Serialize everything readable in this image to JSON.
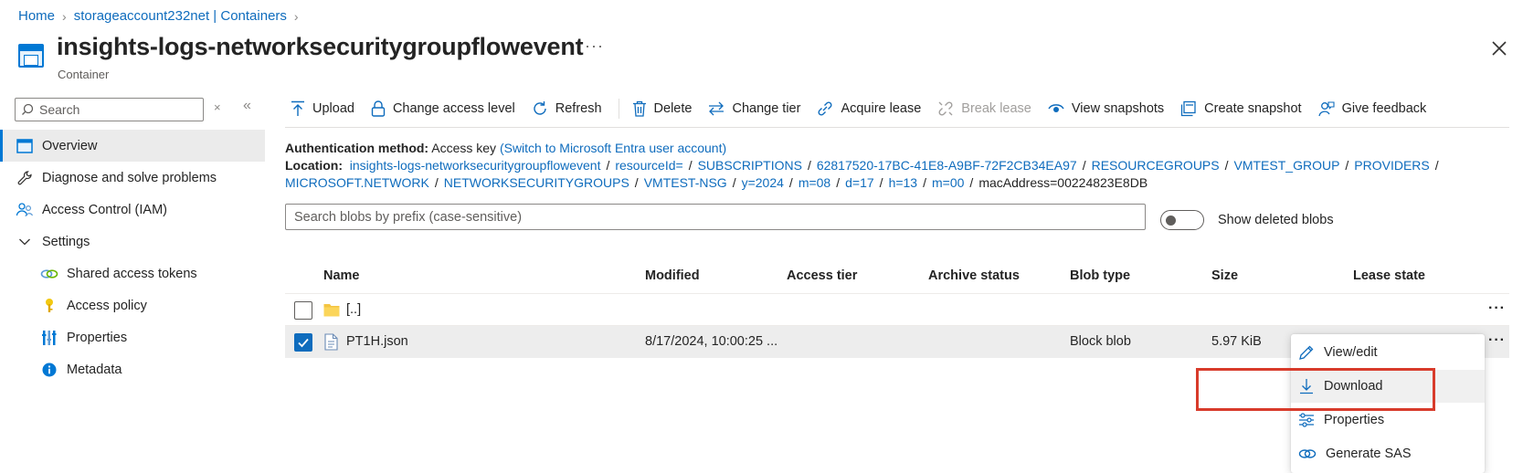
{
  "breadcrumb": {
    "items": [
      "Home",
      "storageaccount232net | Containers"
    ]
  },
  "header": {
    "title": "insights-logs-networksecuritygroupflowevent",
    "subtitle": "Container",
    "more": "···"
  },
  "sidebar": {
    "search_placeholder": "Search",
    "clear": "×",
    "collapse": "«",
    "items": [
      {
        "label": "Overview",
        "icon": "container-overview-icon"
      },
      {
        "label": "Diagnose and solve problems",
        "icon": "wrench-icon"
      },
      {
        "label": "Access Control (IAM)",
        "icon": "people-icon"
      },
      {
        "label": "Settings",
        "icon": "chevron-down-icon"
      },
      {
        "label": "Shared access tokens",
        "icon": "link-icon"
      },
      {
        "label": "Access policy",
        "icon": "key-icon"
      },
      {
        "label": "Properties",
        "icon": "properties-bars-icon"
      },
      {
        "label": "Metadata",
        "icon": "info-icon"
      }
    ]
  },
  "toolbar": {
    "upload": "Upload",
    "change_access": "Change access level",
    "refresh": "Refresh",
    "delete": "Delete",
    "change_tier": "Change tier",
    "acquire_lease": "Acquire lease",
    "break_lease": "Break lease",
    "view_snapshots": "View snapshots",
    "create_snapshot": "Create snapshot",
    "give_feedback": "Give feedback"
  },
  "info": {
    "auth_label": "Authentication method:",
    "auth_value": "Access key",
    "auth_switch": "(Switch to Microsoft Entra user account)",
    "location_label": "Location:",
    "path_line1": [
      "insights-logs-networksecuritygroupflowevent",
      "resourceId=",
      "SUBSCRIPTIONS",
      "62817520-17BC-41E8-A9BF-72F2CB34EA97",
      "RESOURCEGROUPS",
      "VMTEST_GROUP",
      "PROVIDERS"
    ],
    "path_line2": [
      "MICROSOFT.NETWORK",
      "NETWORKSECURITYGROUPS",
      "VMTEST-NSG",
      "y=2024",
      "m=08",
      "d=17",
      "h=13",
      "m=00"
    ],
    "path_last": "macAddress=00224823E8DB",
    "separator": "/"
  },
  "blob_search": {
    "placeholder": "Search blobs by prefix (case-sensitive)"
  },
  "show_deleted": {
    "label": "Show deleted blobs",
    "on": false
  },
  "table": {
    "columns": [
      "Name",
      "Modified",
      "Access tier",
      "Archive status",
      "Blob type",
      "Size",
      "Lease state"
    ],
    "rows": [
      {
        "name": "[..]",
        "modified": "",
        "access_tier": "",
        "archive_status": "",
        "blob_type": "",
        "size": "",
        "lease_state": "",
        "checked": false
      },
      {
        "name": "PT1H.json",
        "modified": "8/17/2024, 10:00:25 ...",
        "access_tier": "",
        "archive_status": "",
        "blob_type": "Block blob",
        "size": "5.97 KiB",
        "lease_state": "",
        "checked": true
      }
    ],
    "more": "···"
  },
  "context_menu": {
    "items": [
      "View/edit",
      "Download",
      "Properties",
      "Generate SAS"
    ],
    "highlighted": "Download"
  },
  "colors": {
    "accent": "#0f6cbd",
    "highlight": "#d83b2b"
  }
}
